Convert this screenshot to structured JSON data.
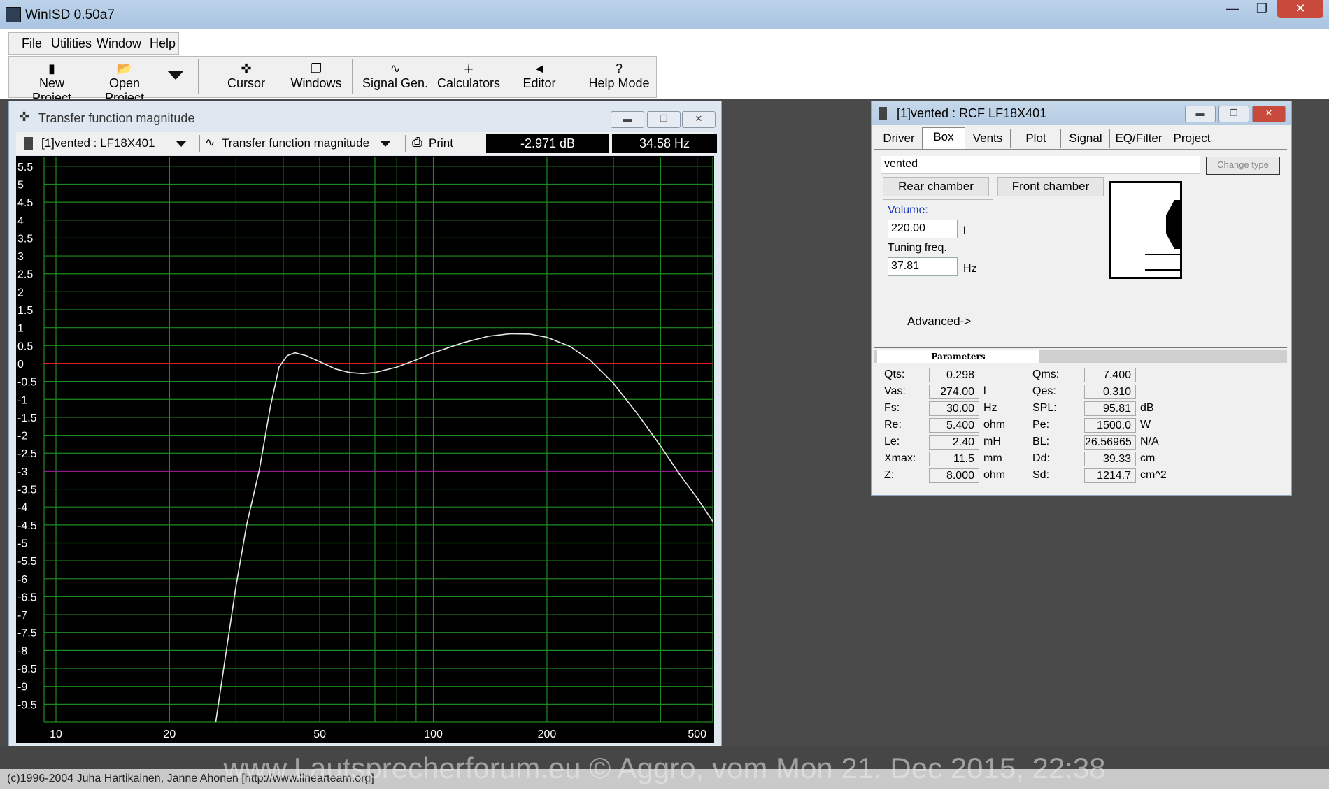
{
  "app": {
    "title": "WinISD 0.50a7"
  },
  "menu": [
    "File",
    "Utilities",
    "Window",
    "Help"
  ],
  "toolbar": {
    "new_project": "New Project",
    "open_project": "Open Project",
    "cursor": "Cursor",
    "windows": "Windows",
    "signal_gen": "Signal Gen.",
    "calculators": "Calculators",
    "editor": "Editor",
    "help_mode": "Help Mode"
  },
  "chart_window": {
    "title": "Transfer function magnitude",
    "project_select": "[1]vented : LF18X401",
    "plot_select": "Transfer function magnitude",
    "print": "Print",
    "readout_db": "-2.971 dB",
    "readout_hz": "34.58 Hz"
  },
  "chart_data": {
    "type": "line",
    "title": "",
    "xlabel": "",
    "ylabel": "",
    "x_scale": "log",
    "xlim": [
      9.3,
      550
    ],
    "ylim": [
      -10,
      5.75
    ],
    "y_ticks": [
      "5.5",
      "5",
      "4.5",
      "4",
      "3.5",
      "3",
      "2.5",
      "2",
      "1.5",
      "1",
      "0.5",
      "0",
      "-0.5",
      "-1",
      "-1.5",
      "-2",
      "-2.5",
      "-3",
      "-3.5",
      "-4",
      "-4.5",
      "-5",
      "-5.5",
      "-6",
      "-6.5",
      "-7",
      "-7.5",
      "-8",
      "-8.5",
      "-9",
      "-9.5"
    ],
    "x_ticks": [
      "10",
      "20",
      "50",
      "100",
      "200",
      "500"
    ],
    "grid": true,
    "reference_lines": [
      {
        "y": 0,
        "color": "#e02020"
      },
      {
        "y": -3,
        "color": "#a020a0"
      }
    ],
    "series": [
      {
        "color": "#e8e8e8",
        "x": [
          26.5,
          28,
          30,
          32,
          34.58,
          37,
          39,
          41,
          43,
          46,
          50,
          55,
          60,
          65,
          70,
          80,
          90,
          100,
          120,
          140,
          160,
          180,
          200,
          230,
          260,
          300,
          350,
          400,
          450,
          500,
          550
        ],
        "y": [
          -10,
          -8.3,
          -6.2,
          -4.5,
          -2.97,
          -1.2,
          -0.1,
          0.22,
          0.3,
          0.22,
          0.05,
          -0.15,
          -0.25,
          -0.28,
          -0.25,
          -0.1,
          0.1,
          0.3,
          0.58,
          0.76,
          0.83,
          0.82,
          0.73,
          0.48,
          0.1,
          -0.55,
          -1.45,
          -2.3,
          -3.1,
          -3.75,
          -4.4
        ]
      }
    ]
  },
  "driver_window": {
    "title": "[1]vented : RCF LF18X401",
    "tabs": [
      "Driver",
      "Box",
      "Vents",
      "Plot",
      "Signal",
      "EQ/Filter",
      "Project"
    ],
    "box_type": "vented",
    "change_button": "Change type",
    "rear_chamber": "Rear chamber",
    "front_chamber": "Front chamber",
    "volume_label": "Volume:",
    "volume_value": "220.00",
    "volume_unit": "l",
    "tuning_label": "Tuning freq.",
    "tuning_value": "37.81",
    "tuning_unit": "Hz",
    "advanced": "Advanced->",
    "parameters_title": "Parameters",
    "params_left": [
      {
        "label": "Qts:",
        "value": "0.298",
        "unit": ""
      },
      {
        "label": "Vas:",
        "value": "274.00",
        "unit": "l"
      },
      {
        "label": "Fs:",
        "value": "30.00",
        "unit": "Hz"
      },
      {
        "label": "Re:",
        "value": "5.400",
        "unit": "ohm"
      },
      {
        "label": "Le:",
        "value": "2.40",
        "unit": "mH"
      },
      {
        "label": "Xmax:",
        "value": "11.5",
        "unit": "mm"
      },
      {
        "label": "Z:",
        "value": "8.000",
        "unit": "ohm"
      }
    ],
    "params_right": [
      {
        "label": "Qms:",
        "value": "7.400",
        "unit": ""
      },
      {
        "label": "Qes:",
        "value": "0.310",
        "unit": ""
      },
      {
        "label": "SPL:",
        "value": "95.81",
        "unit": "dB"
      },
      {
        "label": "Pe:",
        "value": "1500.0",
        "unit": "W"
      },
      {
        "label": "BL:",
        "value": "26.56965",
        "unit": "N/A"
      },
      {
        "label": "Dd:",
        "value": "39.33",
        "unit": "cm"
      },
      {
        "label": "Sd:",
        "value": "1214.7",
        "unit": "cm^2"
      }
    ]
  },
  "watermark": "www.Lautsprecherforum.eu © Aggro, vom Mon 21. Dec 2015, 22:38",
  "statusbar": "(c)1996-2004 Juha Hartikainen, Janne Ahonen [http://www.linearteam.org]"
}
